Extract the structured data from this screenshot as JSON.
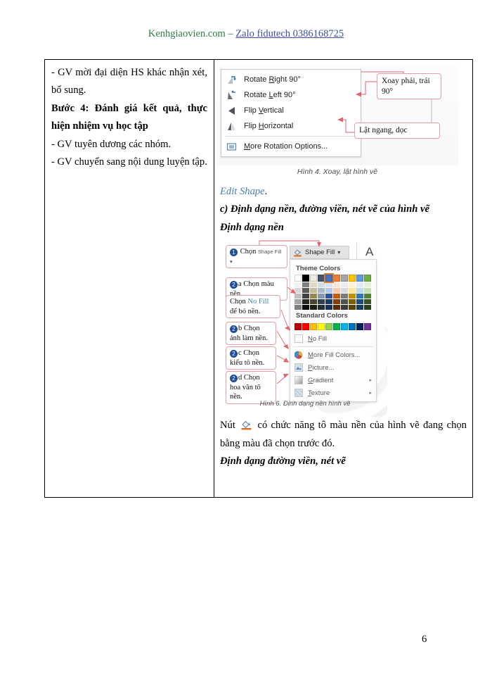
{
  "header": {
    "site": "Kenhgiaovien.com",
    "separator": " – ",
    "zalo": "Zalo fidutech 0386168725"
  },
  "table": {
    "left_cell": {
      "paragraphs": [
        {
          "text": "- GV mời đại diện HS khác nhận xét, bổ sung.",
          "bold": false
        },
        {
          "text": "Bước 4: Đánh giá kết quả, thực hiện nhiệm vụ học tập",
          "bold": true
        },
        {
          "text": "- GV tuyên dương các nhóm.",
          "bold": false
        },
        {
          "text": "- GV chuyển sang nội dung luyện tập.",
          "bold": false
        }
      ]
    },
    "right_cell": {
      "figure4": {
        "menu_items": [
          {
            "label_pre": "Rotate ",
            "label_key": "R",
            "label_post": "ight 90°",
            "icon": "rotate-right-icon"
          },
          {
            "label_pre": "Rotate ",
            "label_key": "L",
            "label_post": "eft 90°",
            "icon": "rotate-left-icon"
          },
          {
            "label_pre": "Flip ",
            "label_key": "V",
            "label_post": "ertical",
            "icon": "flip-vertical-icon"
          },
          {
            "label_pre": "Flip ",
            "label_key": "H",
            "label_post": "orizontal",
            "icon": "flip-horizontal-icon"
          },
          {
            "label_pre": "",
            "label_key": "M",
            "label_post": "ore Rotation Options...",
            "icon": "more-rotation-options-icon"
          }
        ],
        "callout_rotate": "Xoay phải, trái 90°",
        "callout_flip": "Lật ngang, dọc",
        "caption": "Hình 4. Xoay, lật hình vẽ"
      },
      "edit_shape_line": {
        "link": "Edit Shape",
        "tail": "."
      },
      "section_c": "c) Định dạng nền, đường viền, nét vẽ của hình vẽ",
      "subheading_bg": "Định dạng nền",
      "figure6": {
        "button_label": "Shape Fill",
        "button_caret": "▾",
        "a_icon": "A",
        "theme_label": "Theme Colors",
        "standard_label": "Standard Colors",
        "theme_colors": [
          [
            "#FFFFFF",
            "#F2F2F2",
            "#D8D8D8",
            "#BFBFBF",
            "#A5A5A5",
            "#7F7F7F"
          ],
          [
            "#000000",
            "#808080",
            "#595959",
            "#404040",
            "#262626",
            "#0D0D0D"
          ],
          [
            "#EEECE1",
            "#DDD9C3",
            "#C4BD97",
            "#938953",
            "#494429",
            "#1D1B10"
          ],
          [
            "#44546A",
            "#D6DCE4",
            "#ADB9CA",
            "#8496B0",
            "#333F4F",
            "#222A35"
          ],
          [
            "#4472C4",
            "#D9E2F3",
            "#B4C6E7",
            "#2E5496",
            "#1F3864",
            "#172F5C"
          ],
          [
            "#ED7D31",
            "#FBE5D5",
            "#F7CAAC",
            "#C55A11",
            "#833C0B",
            "#5A2A08"
          ],
          [
            "#A5A5A5",
            "#EDEDED",
            "#DBDBDB",
            "#7B7B7B",
            "#525252",
            "#3B3B3B"
          ],
          [
            "#FFC000",
            "#FFF2CC",
            "#FFE598",
            "#BF9000",
            "#7F6000",
            "#584300"
          ],
          [
            "#5B9BD5",
            "#DEEBF6",
            "#BDD7EE",
            "#2E75B5",
            "#1F4E79",
            "#163C5C"
          ],
          [
            "#70AD47",
            "#E2EFD9",
            "#C5E0B3",
            "#548235",
            "#375623",
            "#27401A"
          ]
        ],
        "theme_selected_index": 4,
        "standard_colors": [
          "#C00000",
          "#FF0000",
          "#FFC000",
          "#FFFF00",
          "#92D050",
          "#00B050",
          "#00B0F0",
          "#0070C0",
          "#002060",
          "#7030A0"
        ],
        "rows": [
          {
            "label_key": "N",
            "label_pre": "",
            "label_post": "o Fill",
            "icon": "no-fill-swatch-icon",
            "submenu": false
          },
          {
            "label_key": "M",
            "label_pre": "",
            "label_post": "ore Fill Colors...",
            "icon": "more-fill-colors-icon",
            "submenu": false
          },
          {
            "label_key": "P",
            "label_pre": "",
            "label_post": "icture...",
            "icon": "picture-icon",
            "submenu": false
          },
          {
            "label_key": "G",
            "label_pre": "",
            "label_post": "radient",
            "icon": "gradient-icon",
            "submenu": true
          },
          {
            "label_key": "T",
            "label_pre": "",
            "label_post": "exture",
            "icon": "texture-icon",
            "submenu": true
          }
        ],
        "submenu_arrow": "▸",
        "callouts": {
          "step1_num": "1",
          "step1_text": "Chọn",
          "step1_chip": "Shape Fill ▾",
          "step2a_num": "2",
          "step2a_text": "a Chọn màu nền.",
          "nofill_pre": "Chọn ",
          "nofill_link": "No Fill",
          "nofill_post": " để bỏ nền.",
          "step2b_num": "2",
          "step2b_text": "b Chọn ảnh làm nền.",
          "step2c_num": "2",
          "step2c_text": "c Chọn kiểu tô nền.",
          "step2d_num": "2",
          "step2d_text": "d Chọn hoa văn tô nền."
        },
        "caption": "Hình 6. Định dạng nền hình vẽ"
      },
      "bucket_paragraph": {
        "pre": "Nút ",
        "post": " có chức năng tô màu nền của hình vẽ đang chọn bằng màu đã chọn trước đó."
      },
      "subheading_border": "Định dạng đường viền, nét vẽ"
    }
  },
  "page_number": "6"
}
